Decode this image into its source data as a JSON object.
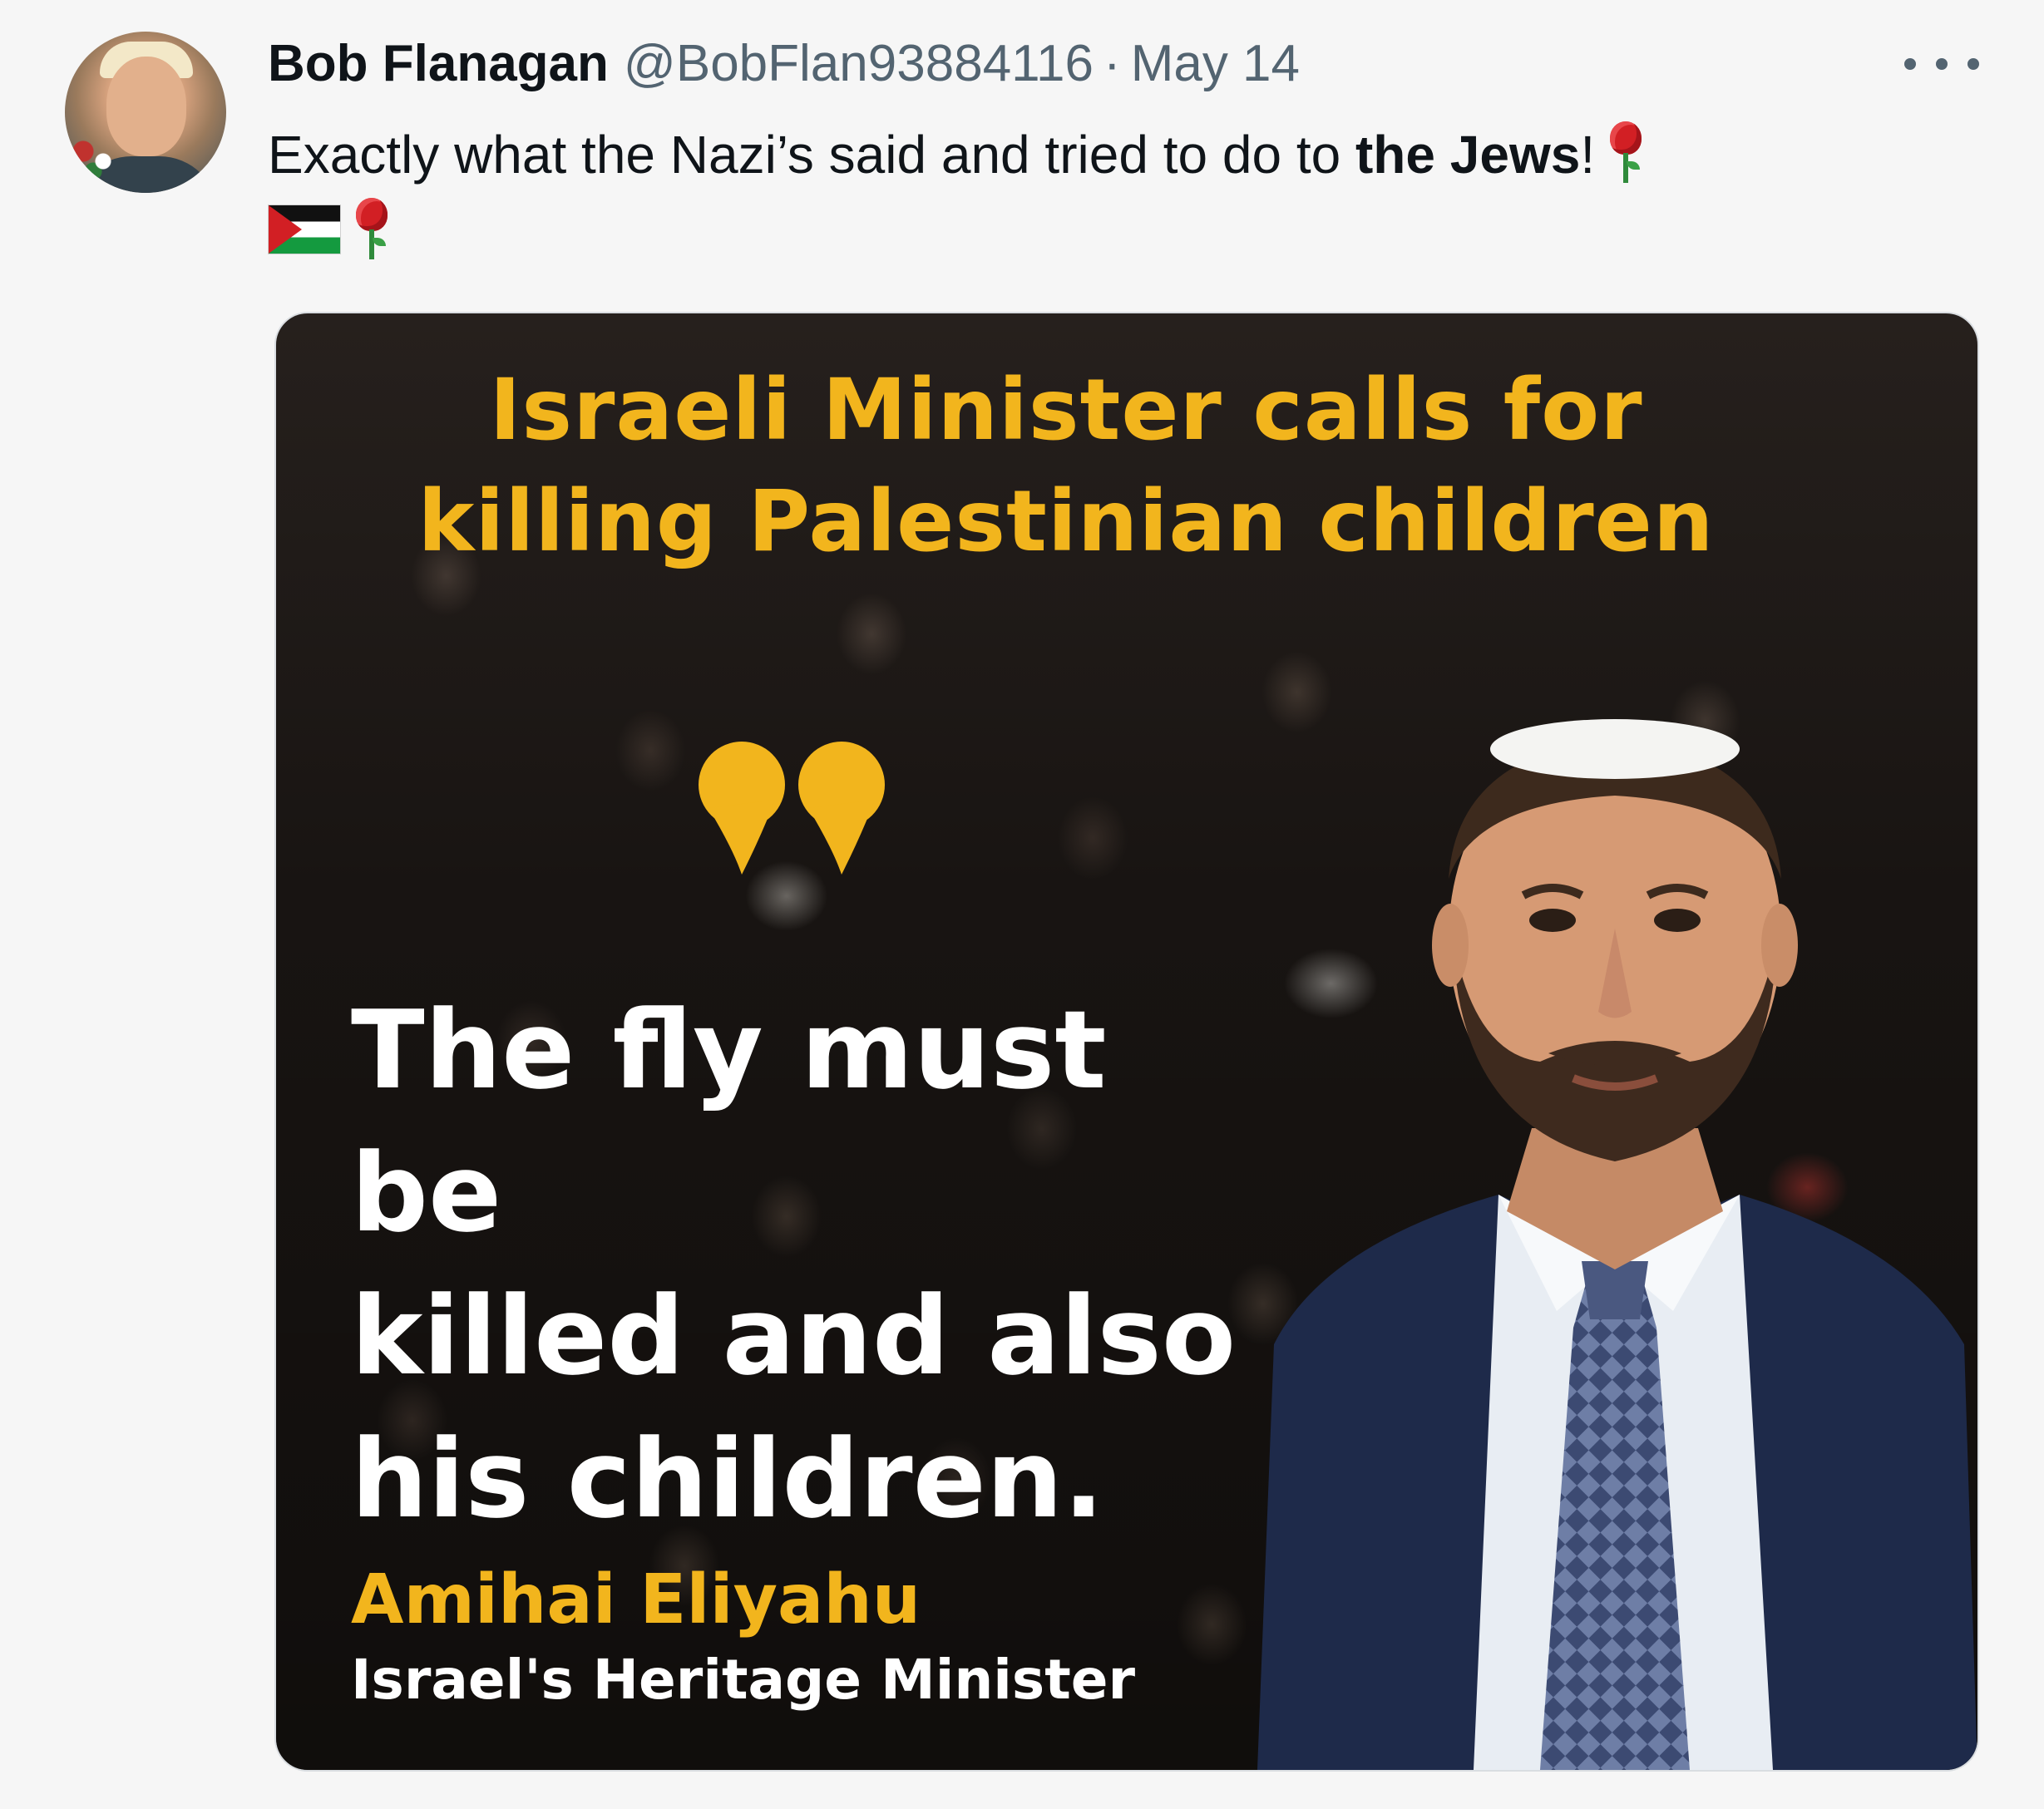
{
  "author": {
    "display_name": "Bob Flanagan",
    "handle": "@BobFlan93884116",
    "separator": "·",
    "date": "May 14"
  },
  "tweet": {
    "text_before_bold": "Exactly what the Nazi’s said and tried to do to ",
    "text_bold": "the Jews",
    "text_after_bold": "!",
    "emoji": [
      "rose-emoji",
      "palestine-flag-emoji",
      "rose-emoji"
    ]
  },
  "media": {
    "headline_line1": "Israeli Minister calls for",
    "headline_line2": "killing Palestinian children",
    "quote_line1": "The fly must be",
    "quote_line2": "killed and also",
    "quote_line3": "his children.",
    "speaker_name": "Amihai Eliyahu",
    "speaker_title": "Israel's Heritage Minister"
  },
  "colors": {
    "accent_yellow": "#f2b51d",
    "meta_gray": "#536471",
    "text_dark": "#0f1419"
  },
  "icons": [
    "more-icon",
    "quote-icon"
  ]
}
